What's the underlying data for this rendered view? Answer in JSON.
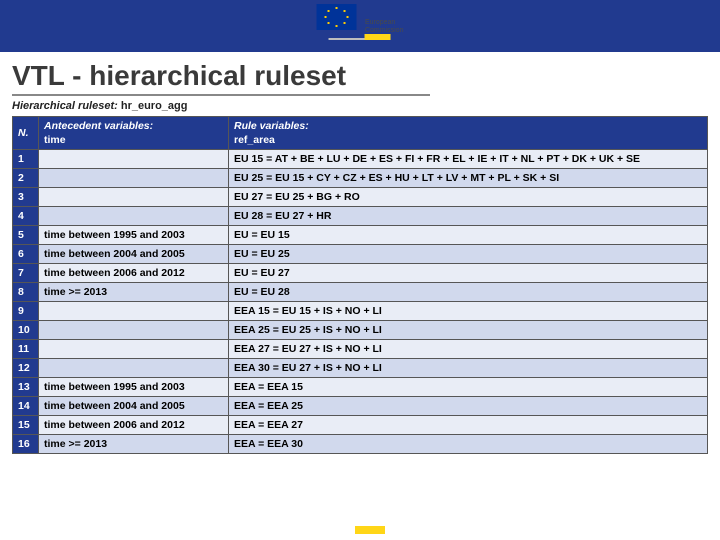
{
  "logo": {
    "org": "European",
    "org2": "Commission"
  },
  "title": "VTL - hierarchical ruleset",
  "subtitle_label": "Hierarchical ruleset: ",
  "subtitle_value": "hr_euro_agg",
  "headers": {
    "n": "N.",
    "antecedent_label": "Antecedent variables:",
    "antecedent_sub": "time",
    "rule_label": "Rule variables:",
    "rule_sub": "ref_area"
  },
  "rows": [
    {
      "n": "1",
      "ant": "",
      "rule": "EU 15 = AT + BE + LU + DE + ES + FI + FR + EL + IE + IT + NL + PT + DK + UK + SE"
    },
    {
      "n": "2",
      "ant": "",
      "rule": "EU 25 = EU 15 + CY + CZ + ES + HU + LT + LV + MT + PL + SK + SI"
    },
    {
      "n": "3",
      "ant": "",
      "rule": "EU 27 = EU 25 + BG + RO"
    },
    {
      "n": "4",
      "ant": "",
      "rule": "EU 28 = EU 27 + HR"
    },
    {
      "n": "5",
      "ant": "time between 1995 and 2003",
      "rule": "EU = EU 15"
    },
    {
      "n": "6",
      "ant": "time between 2004 and 2005",
      "rule": "EU = EU 25"
    },
    {
      "n": "7",
      "ant": "time between 2006 and 2012",
      "rule": "EU = EU 27"
    },
    {
      "n": "8",
      "ant": "time >= 2013",
      "rule": "EU = EU 28"
    },
    {
      "n": "9",
      "ant": "",
      "rule": "EEA 15 = EU 15 + IS + NO + LI"
    },
    {
      "n": "10",
      "ant": "",
      "rule": "EEA 25 = EU 25 + IS + NO + LI"
    },
    {
      "n": "11",
      "ant": "",
      "rule": "EEA 27 = EU 27 + IS + NO + LI"
    },
    {
      "n": "12",
      "ant": "",
      "rule": "EEA 30 = EU 27 + IS + NO + LI"
    },
    {
      "n": "13",
      "ant": "time between 1995 and 2003",
      "rule": "EEA = EEA 15"
    },
    {
      "n": "14",
      "ant": "time between 2004 and 2005",
      "rule": "EEA = EEA 25"
    },
    {
      "n": "15",
      "ant": "time between 2006 and 2012",
      "rule": "EEA = EEA 27"
    },
    {
      "n": "16",
      "ant": "time >= 2013",
      "rule": "EEA = EEA 30"
    }
  ]
}
